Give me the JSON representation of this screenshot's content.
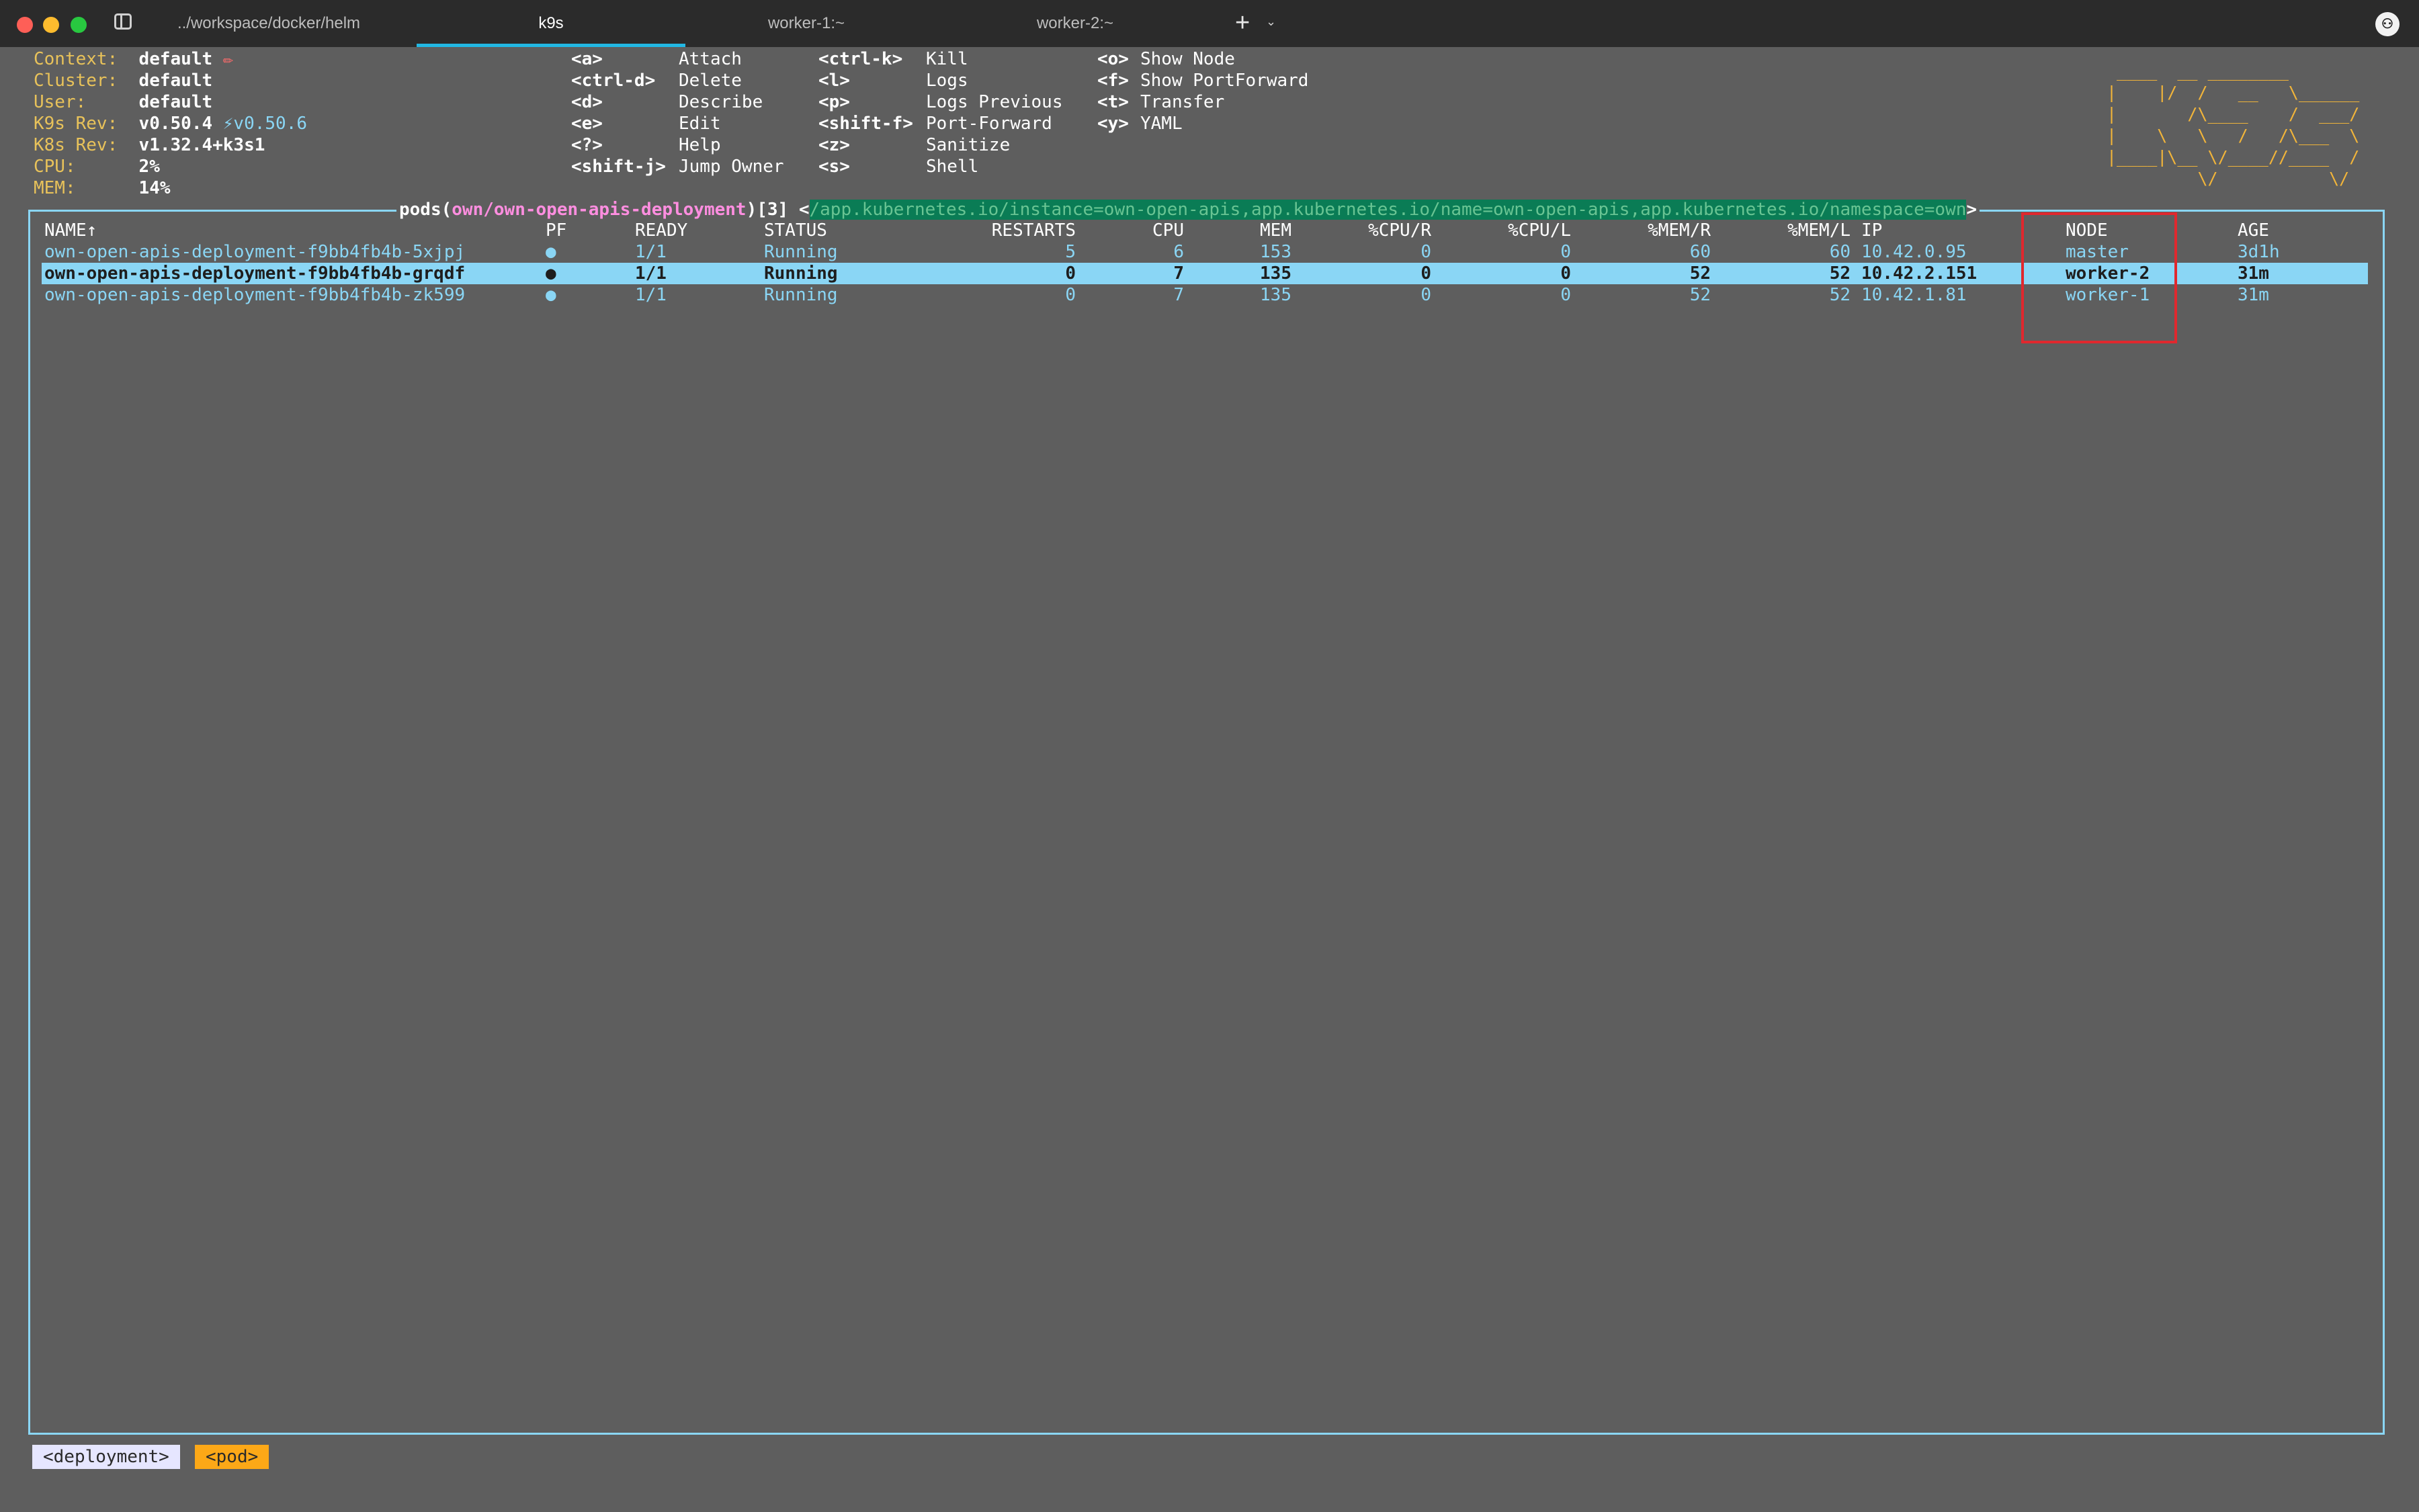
{
  "window": {
    "tabs": [
      {
        "label": "../workspace/docker/helm",
        "active": false
      },
      {
        "label": "k9s",
        "active": true
      },
      {
        "label": "worker-1:~",
        "active": false
      },
      {
        "label": "worker-2:~",
        "active": false
      }
    ],
    "new_tab_symbol": "+",
    "accent": "#22b8e3"
  },
  "info": [
    {
      "key": "Context:",
      "value": "default",
      "extra": "✏"
    },
    {
      "key": "Cluster:",
      "value": "default",
      "extra": ""
    },
    {
      "key": "User:",
      "value": "default",
      "extra": ""
    },
    {
      "key": "K9s Rev:",
      "value": "v0.50.4",
      "extra": "⚡v0.50.6"
    },
    {
      "key": "K8s Rev:",
      "value": "v1.32.4+k3s1",
      "extra": ""
    },
    {
      "key": "CPU:",
      "value": "2%",
      "extra": ""
    },
    {
      "key": "MEM:",
      "value": "14%",
      "extra": ""
    }
  ],
  "shortcuts": {
    "col1": [
      {
        "key": "<a>",
        "label": "Attach"
      },
      {
        "key": "<ctrl-d>",
        "label": "Delete"
      },
      {
        "key": "<d>",
        "label": "Describe"
      },
      {
        "key": "<e>",
        "label": "Edit"
      },
      {
        "key": "<?>",
        "label": "Help"
      },
      {
        "key": "<shift-j>",
        "label": "Jump Owner"
      }
    ],
    "col2": [
      {
        "key": "<ctrl-k>",
        "label": "Kill"
      },
      {
        "key": "<l>",
        "label": "Logs"
      },
      {
        "key": "<p>",
        "label": "Logs Previous"
      },
      {
        "key": "<shift-f>",
        "label": "Port-Forward"
      },
      {
        "key": "<z>",
        "label": "Sanitize"
      },
      {
        "key": "<s>",
        "label": "Shell"
      }
    ],
    "col3": [
      {
        "key": "<o>",
        "label": "Show Node"
      },
      {
        "key": "<f>",
        "label": "Show PortForward"
      },
      {
        "key": "<t>",
        "label": "Transfer"
      },
      {
        "key": "<y>",
        "label": "YAML"
      }
    ]
  },
  "logo": " ____  __ ________\n|    |/  /   __   \\______\n|       /\\____    /  ___/\n|    \\   \\   /   /\\___  \\\n|____|\\__ \\/____//____  /\n         \\/           \\/",
  "frame": {
    "prefix": "pods(",
    "namespace": "own/own-open-apis-deployment",
    "suffix": ")[3] <",
    "filter": "/app.kubernetes.io/instance=own-open-apis,app.kubernetes.io/name=own-open-apis,app.kubernetes.io/namespace=own",
    "close": ">"
  },
  "table": {
    "headers": [
      "NAME↑",
      "PF",
      "READY",
      "STATUS",
      "RESTARTS",
      "CPU",
      "MEM",
      "%CPU/R",
      "%CPU/L",
      "%MEM/R",
      "%MEM/L",
      "IP",
      "NODE",
      "AGE"
    ],
    "rows": [
      {
        "name": "own-open-apis-deployment-f9bb4fb4b-5xjpj",
        "pf": "●",
        "ready": "1/1",
        "status": "Running",
        "restarts": "5",
        "cpu": "6",
        "mem": "153",
        "cpu_r": "0",
        "cpu_l": "0",
        "mem_r": "60",
        "mem_l": "60",
        "ip": "10.42.0.95",
        "node": "master",
        "age": "3d1h",
        "selected": false
      },
      {
        "name": "own-open-apis-deployment-f9bb4fb4b-grqdf",
        "pf": "●",
        "ready": "1/1",
        "status": "Running",
        "restarts": "0",
        "cpu": "7",
        "mem": "135",
        "cpu_r": "0",
        "cpu_l": "0",
        "mem_r": "52",
        "mem_l": "52",
        "ip": "10.42.2.151",
        "node": "worker-2",
        "age": "31m",
        "selected": true
      },
      {
        "name": "own-open-apis-deployment-f9bb4fb4b-zk599",
        "pf": "●",
        "ready": "1/1",
        "status": "Running",
        "restarts": "0",
        "cpu": "7",
        "mem": "135",
        "cpu_r": "0",
        "cpu_l": "0",
        "mem_r": "52",
        "mem_l": "52",
        "ip": "10.42.1.81",
        "node": "worker-1",
        "age": "31m",
        "selected": false
      }
    ]
  },
  "breadcrumbs": [
    "<deployment>",
    "<pod>"
  ]
}
